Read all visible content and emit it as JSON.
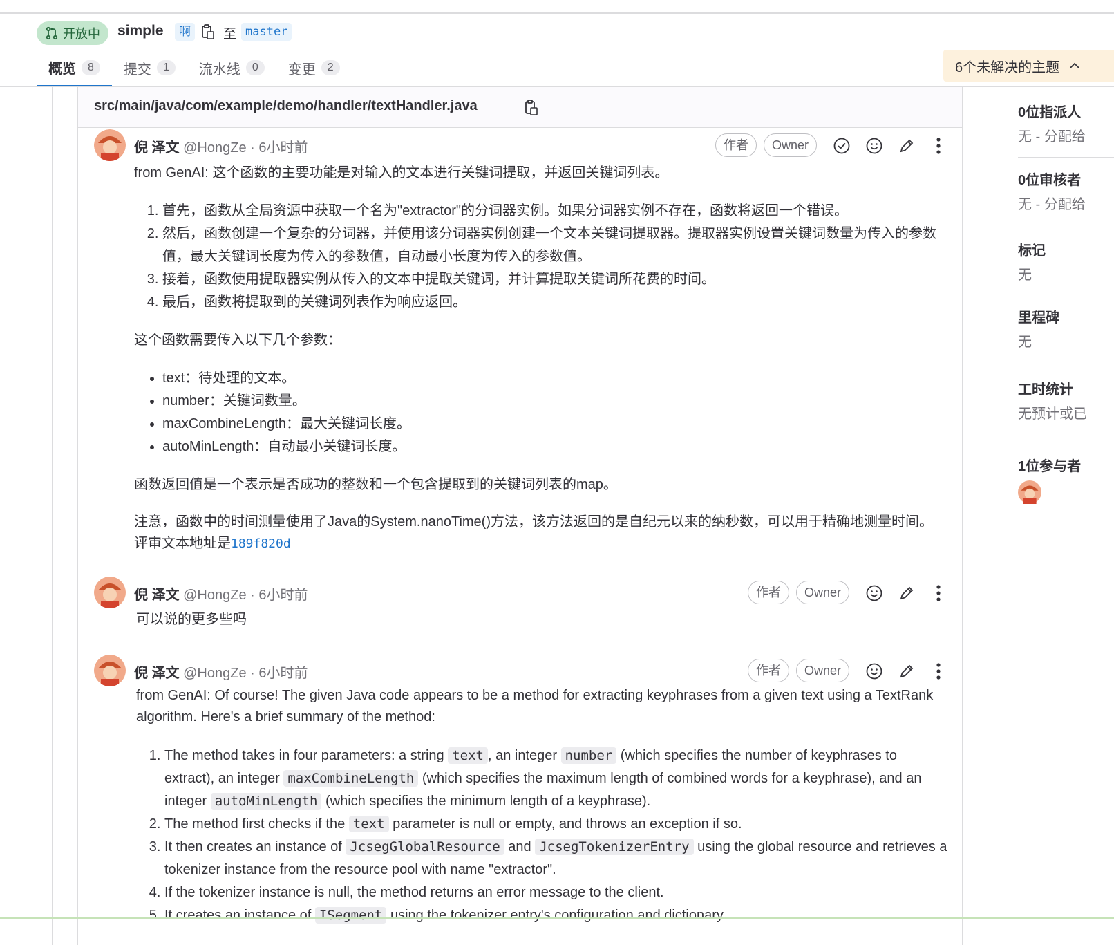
{
  "header": {
    "status": "开放中",
    "title": "simple",
    "source_branch": "啊",
    "to": "至",
    "target_branch": "master"
  },
  "tabs": [
    {
      "label": "概览",
      "count": "8"
    },
    {
      "label": "提交",
      "count": "1"
    },
    {
      "label": "流水线",
      "count": "0"
    },
    {
      "label": "变更",
      "count": "2"
    }
  ],
  "threads_button": "6个未解决的主题",
  "sidebar": {
    "assignees_title": "0位指派人",
    "assignees_value": "无 - 分配给",
    "reviewers_title": "0位审核者",
    "reviewers_value": "无 - 分配给",
    "labels_title": "标记",
    "labels_value": "无",
    "milestone_title": "里程碑",
    "milestone_value": "无",
    "time_title": "工时统计",
    "time_value": "无预计或已",
    "participants_title": "1位参与者"
  },
  "file": {
    "path": "src/main/java/com/example/demo/handler/textHandler.java"
  },
  "notes": [
    {
      "name": "倪 泽文",
      "meta": " @HongZe · 6小时前",
      "badge_author": "作者",
      "badge_owner": "Owner",
      "intro": "from GenAI: 这个函数的主要功能是对输入的文本进行关键词提取，并返回关键词列表。",
      "steps": [
        "首先，函数从全局资源中获取一个名为\"extractor\"的分词器实例。如果分词器实例不存在，函数将返回一个错误。",
        "然后，函数创建一个复杂的分词器，并使用该分词器实例创建一个文本关键词提取器。提取器实例设置关键词数量为传入的参数值，最大关键词长度为传入的参数值，自动最小长度为传入的参数值。",
        "接着，函数使用提取器实例从传入的文本中提取关键词，并计算提取关键词所花费的时间。",
        "最后，函数将提取到的关键词列表作为响应返回。"
      ],
      "params_intro": "这个函数需要传入以下几个参数：",
      "params": [
        "text：待处理的文本。",
        "number：关键词数量。",
        "maxCombineLength：最大关键词长度。",
        "autoMinLength：自动最小关键词长度。"
      ],
      "return_text": "函数返回值是一个表示是否成功的整数和一个包含提取到的关键词列表的map。",
      "note_text": "注意，函数中的时间测量使用了Java的System.nanoTime()方法，该方法返回的是自纪元以来的纳秒数，可以用于精确地测量时间。 评审文本地址是",
      "commit_link": "189f820d"
    },
    {
      "name": "倪 泽文",
      "meta": " @HongZe · 6小时前",
      "badge_author": "作者",
      "badge_owner": "Owner",
      "text": "可以说的更多些吗"
    },
    {
      "name": "倪 泽文",
      "meta": " @HongZe · 6小时前",
      "badge_author": "作者",
      "badge_owner": "Owner",
      "intro": "from GenAI: Of course! The given Java code appears to be a method for extracting keyphrases from a given text using a TextRank algorithm. Here's a brief summary of the method:",
      "s1_a": "The method takes in four parameters: a string ",
      "s1_c1": "text",
      "s1_b": ", an integer ",
      "s1_c2": "number",
      "s1_c": " (which specifies the number of keyphrases to extract), an integer ",
      "s1_c3": "maxCombineLength",
      "s1_d": " (which specifies the maximum length of combined words for a keyphrase), and an integer ",
      "s1_c4": "autoMinLength",
      "s1_e": " (which specifies the minimum length of a keyphrase).",
      "s2_a": "The method first checks if the ",
      "s2_c1": "text",
      "s2_b": " parameter is null or empty, and throws an exception if so.",
      "s3_a": "It then creates an instance of ",
      "s3_c1": "JcsegGlobalResource",
      "s3_b": " and ",
      "s3_c2": "JcsegTokenizerEntry",
      "s3_c": " using the global resource and retrieves a tokenizer instance from the resource pool with name \"extractor\".",
      "s4": "If the tokenizer instance is null, the method returns an error message to the client.",
      "s5_a": "It creates an instance of ",
      "s5_c1": "ISegment",
      "s5_b": " using the tokenizer entry's configuration and dictionary."
    }
  ]
}
